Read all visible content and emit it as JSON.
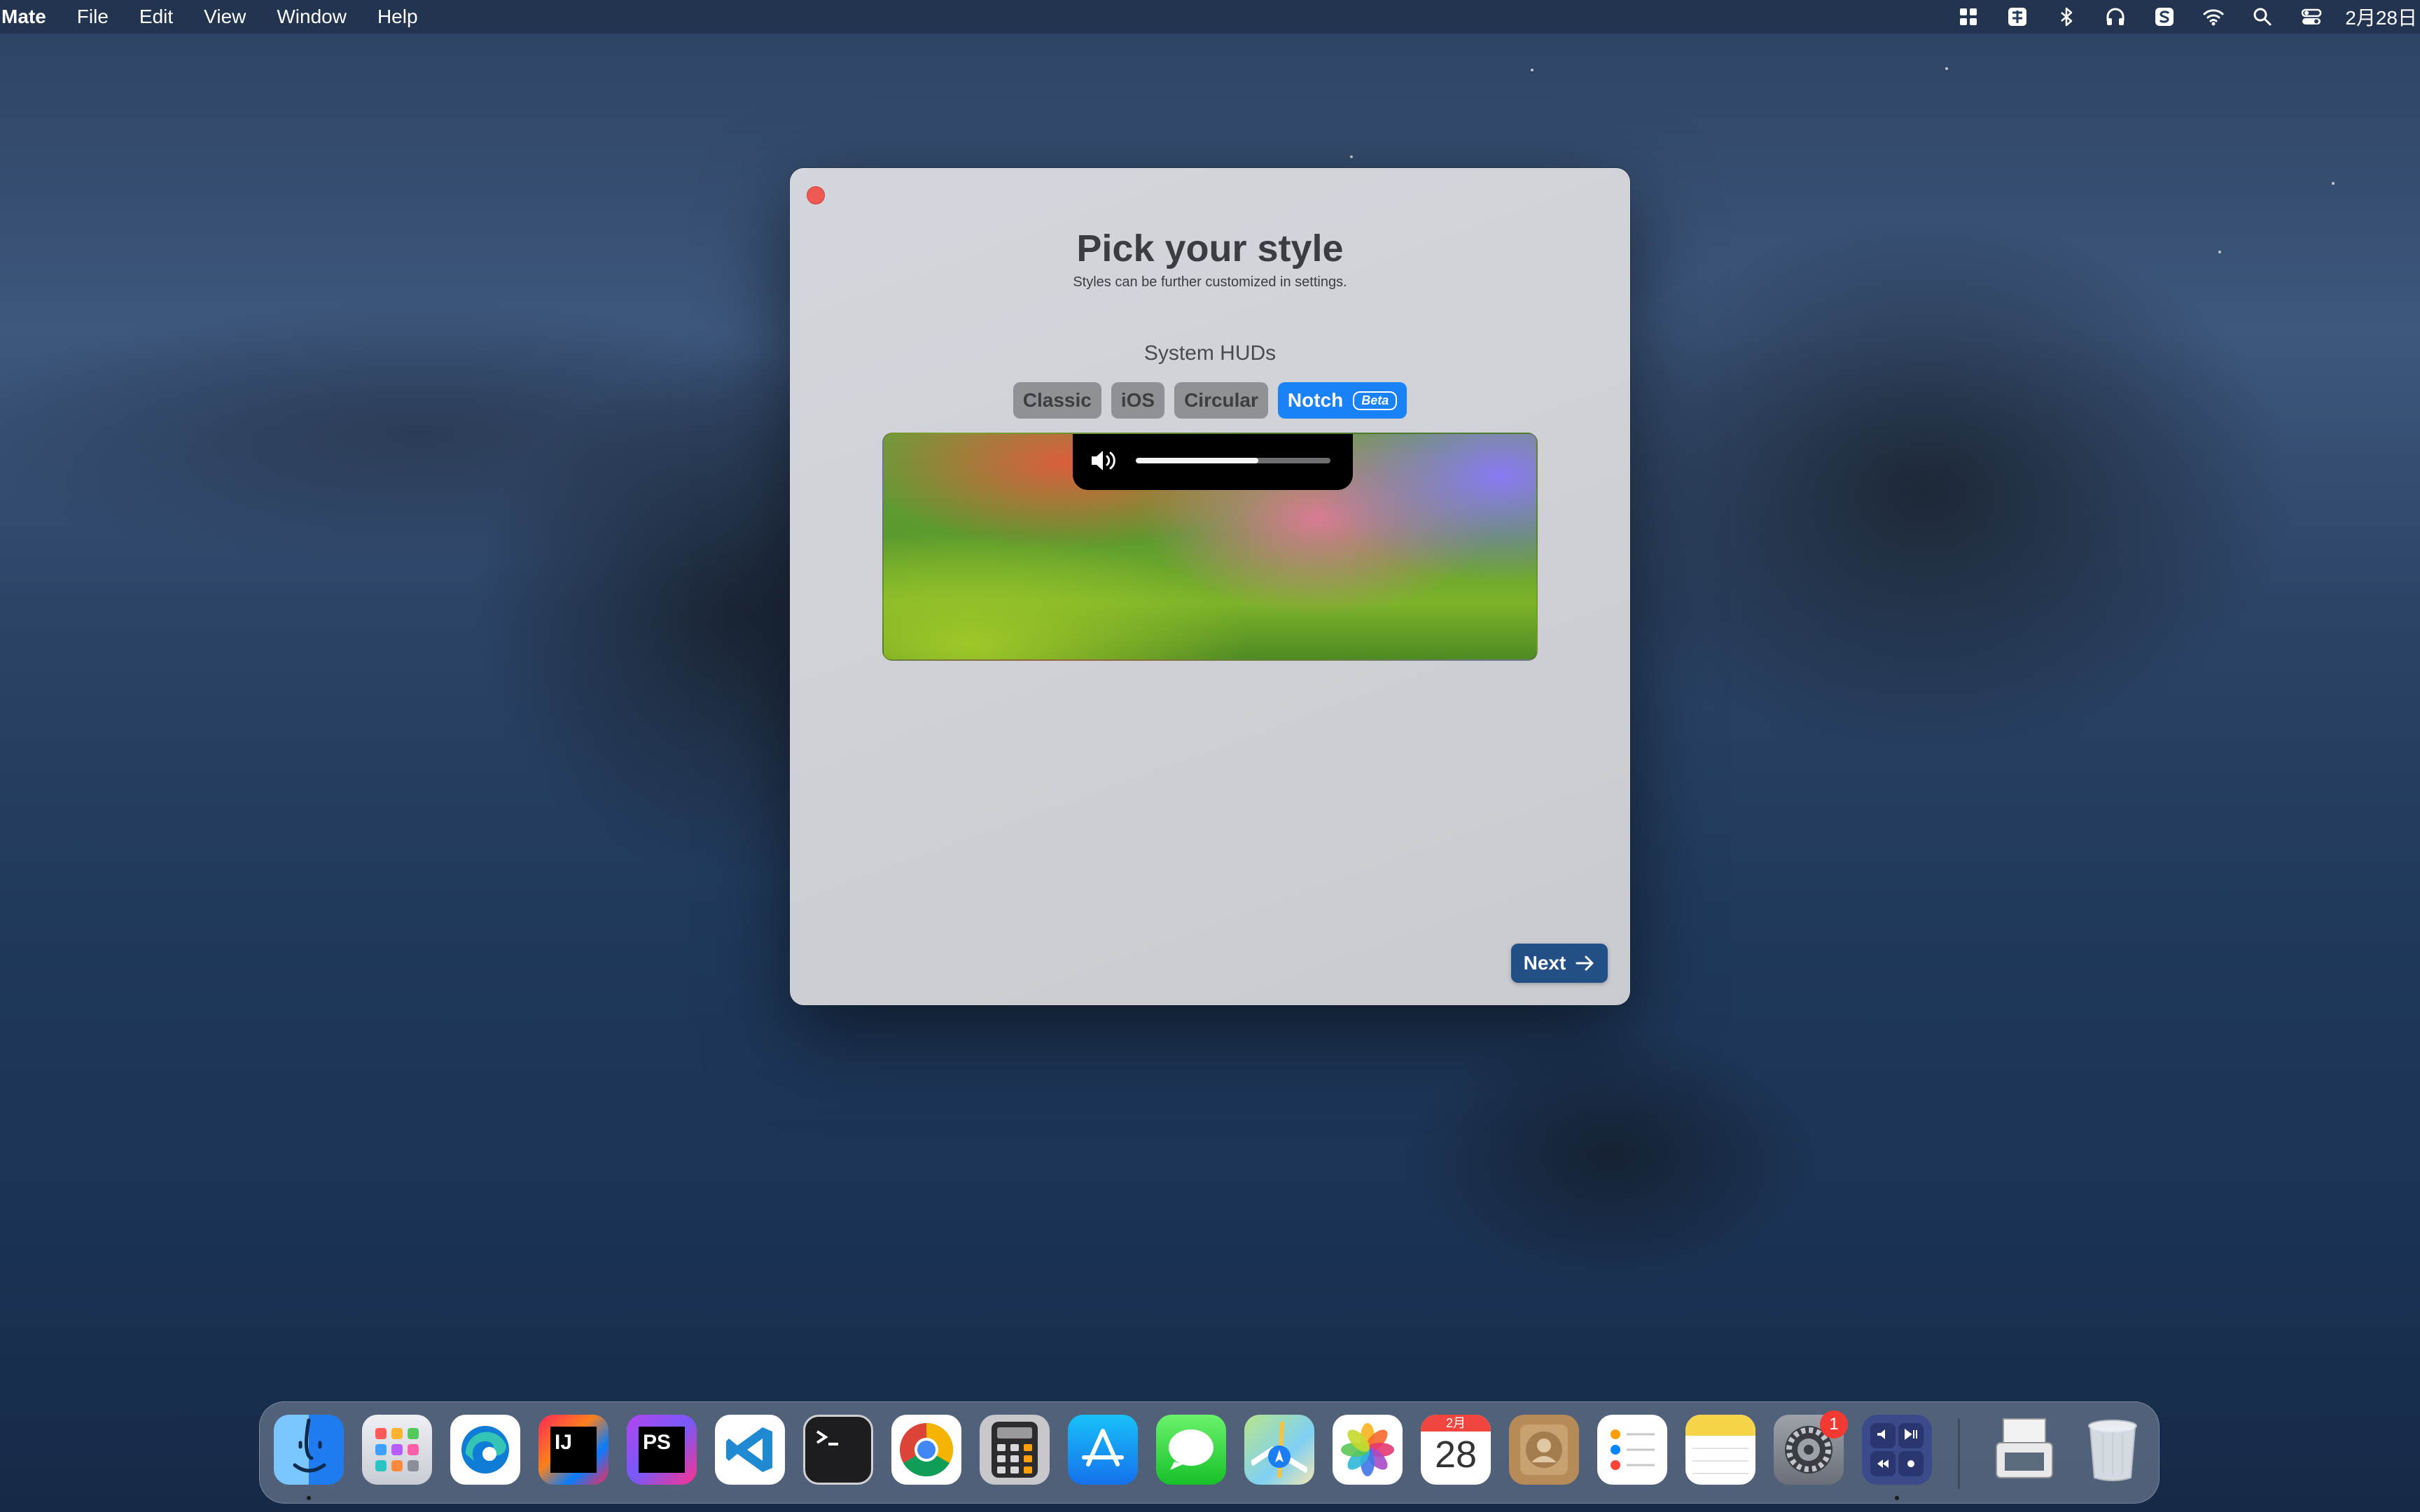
{
  "menubar": {
    "app_name": "Mate",
    "items": [
      "File",
      "Edit",
      "View",
      "Window",
      "Help"
    ],
    "clock": "2月28日"
  },
  "window": {
    "title": "Pick your style",
    "subtitle": "Styles can be further customized in settings.",
    "section_title": "System HUDs",
    "tabs": [
      {
        "label": "Classic",
        "selected": false
      },
      {
        "label": "iOS",
        "selected": false
      },
      {
        "label": "Circular",
        "selected": false
      },
      {
        "label": "Notch",
        "selected": true,
        "badge": "Beta"
      }
    ],
    "preview": {
      "volume_level": 0.63
    },
    "next_label": "Next"
  },
  "dock": {
    "calendar_month": "2月",
    "calendar_day": "28",
    "settings_badge": "1",
    "apps": [
      "finder-icon",
      "launchpad-icon",
      "edge-icon",
      "intellij-icon",
      "phpstorm-icon",
      "vscode-icon",
      "terminal-icon",
      "chrome-icon",
      "calculator-icon",
      "app-store-icon",
      "messages-icon",
      "maps-icon",
      "photos-icon",
      "calendar-icon",
      "contacts-icon",
      "reminders-icon",
      "notes-icon",
      "system-settings-icon",
      "mate-icon",
      "preview-icon",
      "trash-icon"
    ],
    "intellij_label": "IJ",
    "phpstorm_label": "PS"
  },
  "colors": {
    "accent": "#1a82f7",
    "next_button": "#234f87",
    "close": "#ee5a52"
  }
}
